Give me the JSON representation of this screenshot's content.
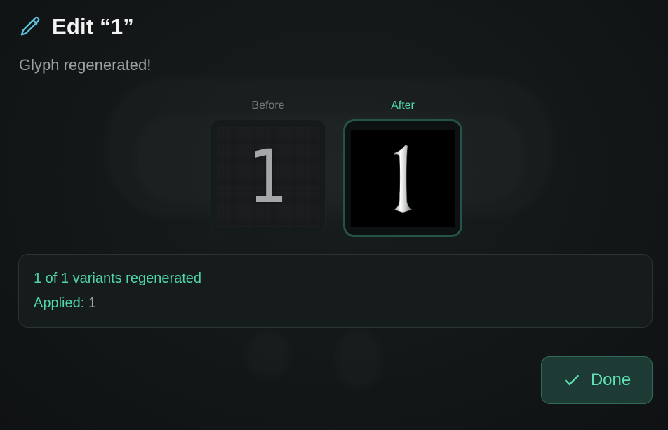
{
  "dialog": {
    "title": "Edit “1”",
    "status": "Glyph regenerated!"
  },
  "comparison": {
    "before_label": "Before",
    "after_label": "After",
    "before_glyph": "1",
    "after_glyph": "1"
  },
  "result": {
    "summary": "1 of 1 variants regenerated",
    "applied_label": "Applied:",
    "applied_value": "1"
  },
  "actions": {
    "done_label": "Done"
  },
  "icons": {
    "header": "pencil-icon",
    "done": "check-icon"
  },
  "colors": {
    "accent": "#4fd6aa",
    "background": "#111516",
    "done_button": "#1d3a34"
  }
}
